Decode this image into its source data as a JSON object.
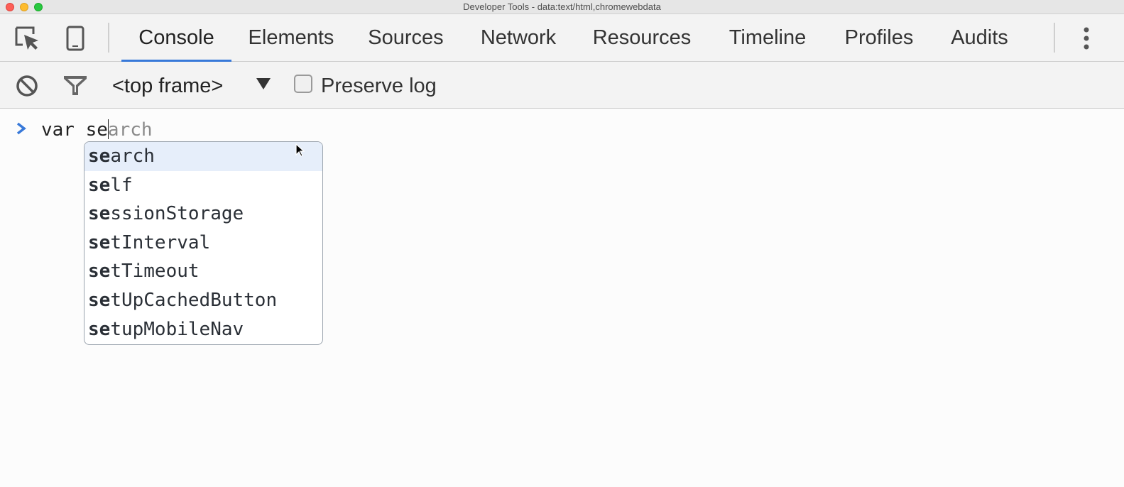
{
  "window": {
    "title": "Developer Tools - data:text/html,chromewebdata"
  },
  "tabs": [
    {
      "label": "Console",
      "active": true
    },
    {
      "label": "Elements",
      "active": false
    },
    {
      "label": "Sources",
      "active": false
    },
    {
      "label": "Network",
      "active": false
    },
    {
      "label": "Resources",
      "active": false
    },
    {
      "label": "Timeline",
      "active": false
    },
    {
      "label": "Profiles",
      "active": false
    },
    {
      "label": "Audits",
      "active": false
    }
  ],
  "toolbar": {
    "frame_label": "<top frame>",
    "preserve_log_label": "Preserve log",
    "preserve_log_checked": false
  },
  "console": {
    "input_typed": "var se",
    "input_ghost": "arch"
  },
  "autocomplete": {
    "prefix": "se",
    "items": [
      {
        "prefix": "se",
        "rest": "arch",
        "selected": true
      },
      {
        "prefix": "se",
        "rest": "lf",
        "selected": false
      },
      {
        "prefix": "se",
        "rest": "ssionStorage",
        "selected": false
      },
      {
        "prefix": "se",
        "rest": "tInterval",
        "selected": false
      },
      {
        "prefix": "se",
        "rest": "tTimeout",
        "selected": false
      },
      {
        "prefix": "se",
        "rest": "tUpCachedButton",
        "selected": false
      },
      {
        "prefix": "se",
        "rest": "tupMobileNav",
        "selected": false
      }
    ]
  },
  "colors": {
    "active_tab_underline": "#3879d9",
    "prompt_chevron": "#3879d9",
    "selected_suggestion_bg": "#e6eefa"
  },
  "icons": [
    "inspect-element-icon",
    "device-mode-icon",
    "more-vertical-icon",
    "clear-console-icon",
    "filter-icon",
    "dropdown-triangle-icon",
    "prompt-chevron-icon",
    "mouse-pointer-icon"
  ]
}
